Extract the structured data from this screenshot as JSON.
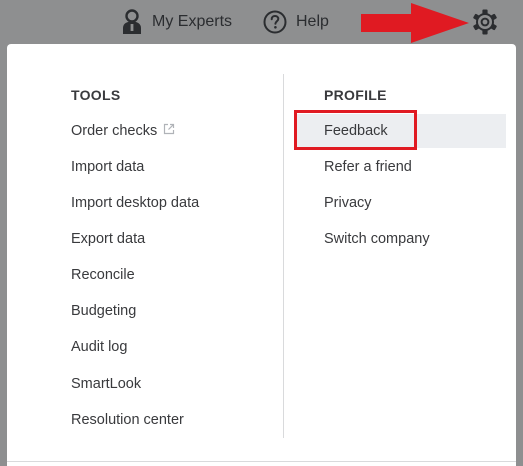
{
  "topbar": {
    "my_experts_label": "My Experts",
    "help_label": "Help",
    "icons": [
      "person-icon",
      "help-icon",
      "gear-icon",
      "red-arrow-annotation"
    ]
  },
  "tools": {
    "heading": "TOOLS",
    "items": [
      {
        "label": "Order checks",
        "external": true
      },
      {
        "label": "Import data"
      },
      {
        "label": "Import desktop data"
      },
      {
        "label": "Export data"
      },
      {
        "label": "Reconcile"
      },
      {
        "label": "Budgeting"
      },
      {
        "label": "Audit log"
      },
      {
        "label": "SmartLook"
      },
      {
        "label": "Resolution center"
      }
    ]
  },
  "profile": {
    "heading": "PROFILE",
    "items": [
      {
        "label": "Feedback",
        "highlighted": true
      },
      {
        "label": "Refer a friend"
      },
      {
        "label": "Privacy"
      },
      {
        "label": "Switch company"
      }
    ]
  },
  "colors": {
    "overlay": "#8e8f90",
    "annotation_red": "#e01a22",
    "text": "#393a3d",
    "hover_bg": "#eceef1"
  }
}
